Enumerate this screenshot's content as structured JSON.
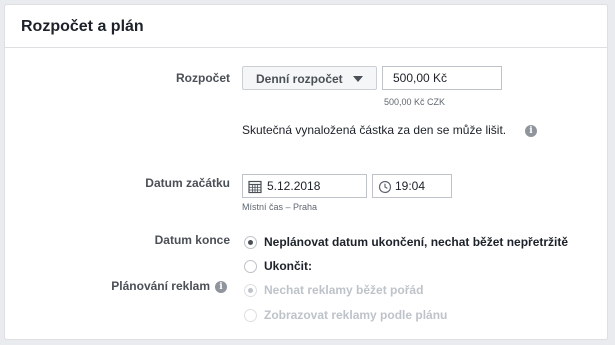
{
  "section": {
    "title": "Rozpočet a plán"
  },
  "budget": {
    "label": "Rozpočet",
    "type_button": "Denní rozpočet",
    "amount_value": "500,00 Kč",
    "amount_helper": "500,00 Kč CZK",
    "note": "Skutečná vynaložená částka za den se může lišit."
  },
  "start": {
    "label": "Datum začátku",
    "date_value": "5.12.2018",
    "time_value": "19:04",
    "timezone": "Místní čas – Praha"
  },
  "end": {
    "label": "Datum konce",
    "options": [
      {
        "label": "Neplánovat datum ukončení, nechat běžet nepřetržitě",
        "checked": true,
        "disabled": false
      },
      {
        "label": "Ukončit:",
        "checked": false,
        "disabled": false
      }
    ]
  },
  "ad_scheduling": {
    "label": "Plánování reklam",
    "options": [
      {
        "label": "Nechat reklamy běžet pořád",
        "checked": true,
        "disabled": true
      },
      {
        "label": "Zobrazovat reklamy podle plánu",
        "checked": false,
        "disabled": true
      }
    ]
  },
  "icons": {
    "info": "info-icon",
    "calendar": "calendar-icon",
    "clock": "clock-icon",
    "caret": "caret-down-icon"
  }
}
